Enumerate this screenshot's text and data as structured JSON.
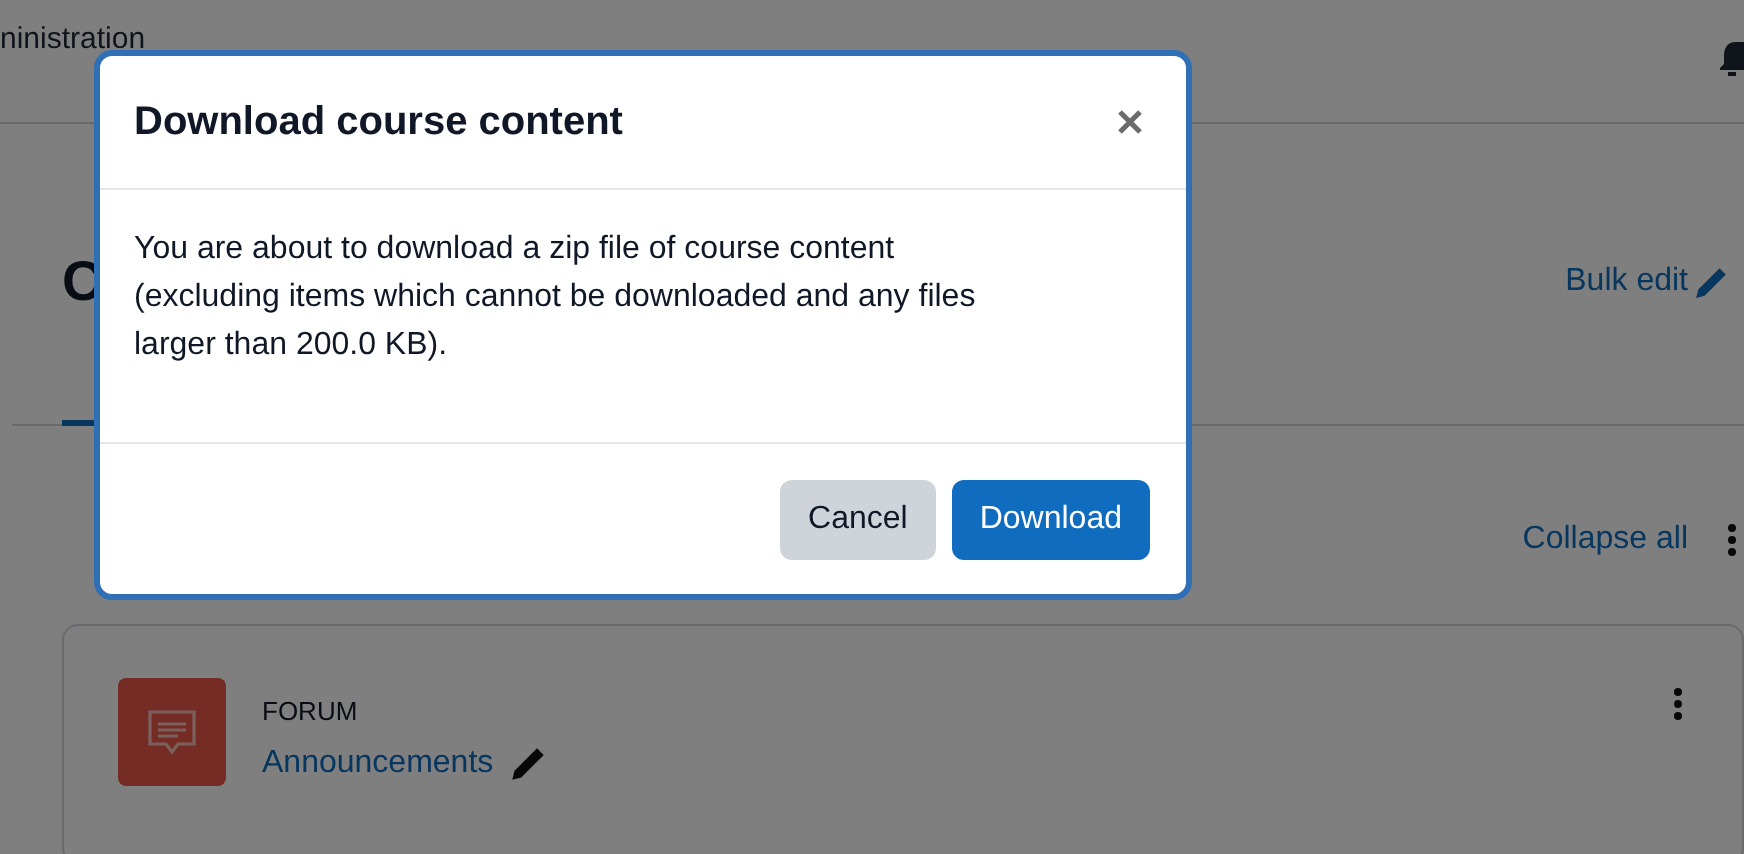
{
  "navbar": {
    "menu_item": "ninistration"
  },
  "page": {
    "heading": "C",
    "bulk_edit": "Bulk edit",
    "collapse_all": "Collapse all"
  },
  "activity": {
    "type": "FORUM",
    "name": "Announcements"
  },
  "dialog": {
    "title": "Download course content",
    "message": "You are about to download a zip file of course content (excluding items which cannot be downloaded and any files larger than 200.0 KB).",
    "buttons": [
      {
        "label": "Cancel",
        "kind": "secondary"
      },
      {
        "label": "Download",
        "kind": "primary"
      }
    ]
  }
}
